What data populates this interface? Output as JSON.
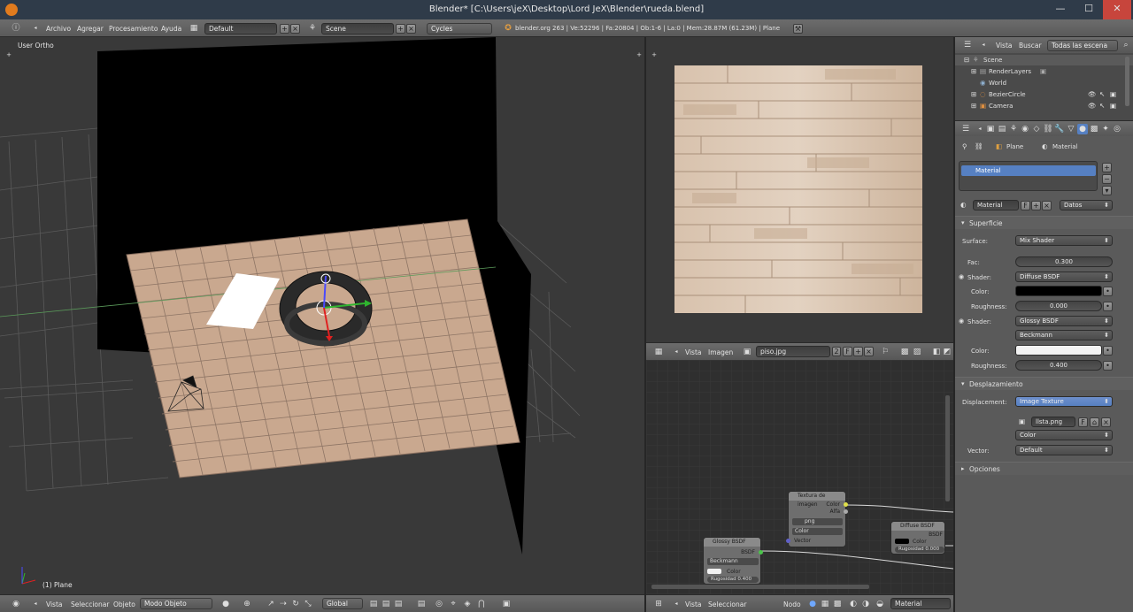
{
  "window": {
    "title": "Blender* [C:\\Users\\jeX\\Desktop\\Lord JeX\\Blender\\rueda.blend]",
    "minimize": "—",
    "maximize": "☐",
    "close": "✕"
  },
  "infobar": {
    "menus": [
      "Archivo",
      "Agregar",
      "Procesamiento",
      "Ayuda"
    ],
    "screen_layout": "Default",
    "scene": "Scene",
    "render_engine": "Cycles",
    "stats": "blender.org 263 | Ve:52296 | Fa:20804 | Ob:1-6 | La:0 | Mem:28.87M (61.23M) | Plane"
  },
  "viewport": {
    "label": "User Ortho",
    "object_label": "(1) Plane",
    "header": {
      "menus": [
        "Vista",
        "Seleccionar",
        "Objeto"
      ],
      "mode": "Modo Objeto",
      "orientation": "Global"
    }
  },
  "image_editor": {
    "header": {
      "menus": [
        "Vista",
        "Imagen"
      ],
      "image_name": "piso.jpg",
      "users": "2",
      "fake": "F"
    }
  },
  "node_editor": {
    "header": {
      "menus": [
        "Vista",
        "Seleccionar",
        "Nodo"
      ],
      "material": "Material"
    },
    "nodes": {
      "image_texture": {
        "title": "Textura de imagen",
        "out_color": "Color",
        "out_alpha": "Alfa",
        "image": "png",
        "colorspace": "Color",
        "in_vector": "Vector"
      },
      "diffuse": {
        "title": "Diffuse BSDF",
        "out": "BSDF",
        "in_color": "Color",
        "in_rough": "Rugosidad 0.000"
      },
      "glossy": {
        "title": "Glossy BSDF",
        "out": "BSDF",
        "dist": "Beckmann",
        "in_color": "Color",
        "in_rough": "Rugosidad 0.400"
      }
    }
  },
  "outliner": {
    "menus": [
      "Vista",
      "Buscar"
    ],
    "filter": "Todas las escena",
    "items": [
      {
        "label": "Scene",
        "depth": 0
      },
      {
        "label": "RenderLayers",
        "depth": 1
      },
      {
        "label": "World",
        "depth": 1
      },
      {
        "label": "BezierCircle",
        "depth": 1
      },
      {
        "label": "Camera",
        "depth": 1
      }
    ]
  },
  "properties": {
    "breadcrumb": [
      "Plane",
      "Material"
    ],
    "slot_list_item": "Material",
    "material_name": "Material",
    "fake_user": "F",
    "link": "Datos",
    "surface_panel": "Superficie",
    "surface_label": "Surface:",
    "surface_value": "Mix Shader",
    "fac_label": "Fac:",
    "fac_value": "0.300",
    "shader1_label": "Shader:",
    "shader1_value": "Diffuse BSDF",
    "color1_label": "Color:",
    "color1_value": "#000000",
    "rough1_label": "Roughness:",
    "rough1_value": "0.000",
    "shader2_label": "Shader:",
    "shader2_value": "Glossy BSDF",
    "dist_value": "Beckmann",
    "color2_label": "Color:",
    "color2_value": "#f2f2f2",
    "rough2_label": "Roughness:",
    "rough2_value": "0.400",
    "displacement_panel": "Desplazamiento",
    "displacement_label": "Displacement:",
    "displacement_value": "Image Texture",
    "image_name": "llsta.png",
    "image_fake": "F",
    "color_mode": "Color",
    "vector_label": "Vector:",
    "vector_value": "Default",
    "options_panel": "Opciones"
  },
  "colors": {
    "accent": "#5680c2",
    "floor": "#c9a88f",
    "header": "#646464",
    "background": "#393939"
  }
}
